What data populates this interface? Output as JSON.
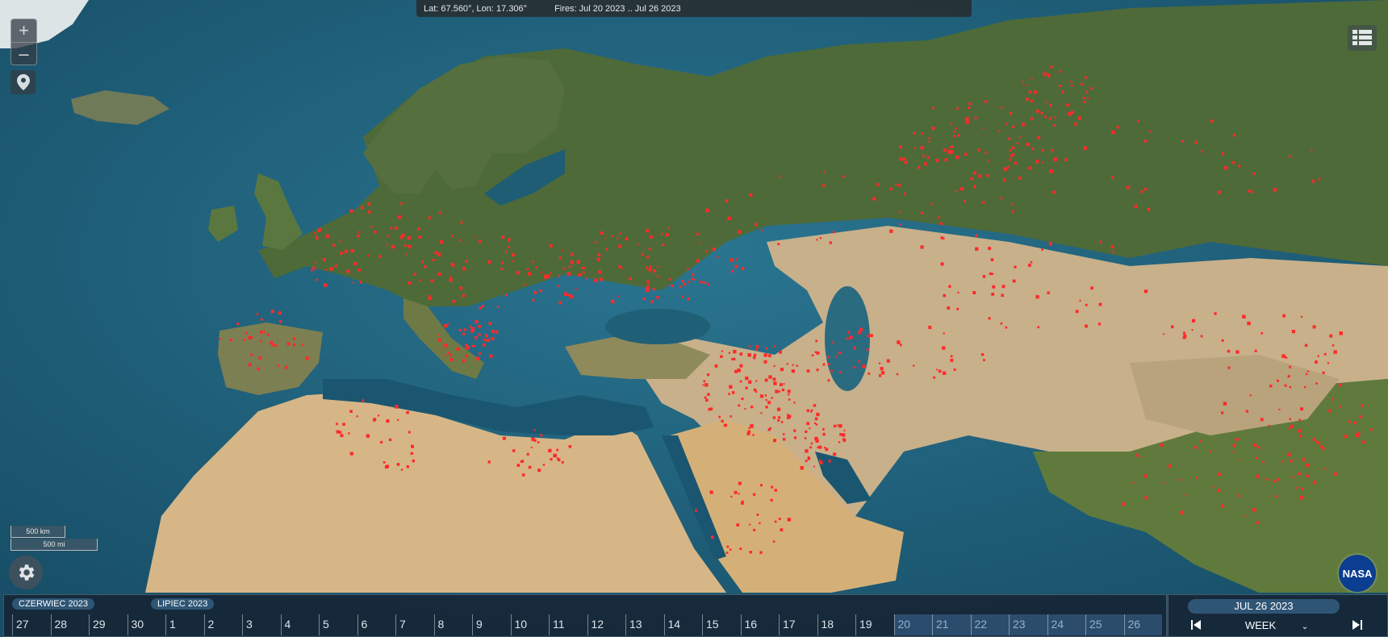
{
  "header": {
    "coords": "Lat: 67.560°, Lon: 17.306°",
    "fires": "Fires: Jul 20 2023 .. Jul 26 2023"
  },
  "map_controls": {
    "zoom_in": "+",
    "zoom_out": "–",
    "location_icon": "map-pin-icon",
    "layers_icon": "layers-list-icon",
    "settings_icon": "gear-icon"
  },
  "scale": {
    "km": "500 km",
    "mi": "500 mi"
  },
  "logo": {
    "text": "NASA"
  },
  "timeline": {
    "months": [
      {
        "label": "CZERWIEC 2023"
      },
      {
        "label": "LIPIEC 2023"
      }
    ],
    "days": [
      {
        "label": "27",
        "selected": false
      },
      {
        "label": "28",
        "selected": false
      },
      {
        "label": "29",
        "selected": false
      },
      {
        "label": "30",
        "selected": false
      },
      {
        "label": "1",
        "selected": false
      },
      {
        "label": "2",
        "selected": false
      },
      {
        "label": "3",
        "selected": false
      },
      {
        "label": "4",
        "selected": false
      },
      {
        "label": "5",
        "selected": false
      },
      {
        "label": "6",
        "selected": false
      },
      {
        "label": "7",
        "selected": false
      },
      {
        "label": "8",
        "selected": false
      },
      {
        "label": "9",
        "selected": false
      },
      {
        "label": "10",
        "selected": false
      },
      {
        "label": "11",
        "selected": false
      },
      {
        "label": "12",
        "selected": false
      },
      {
        "label": "13",
        "selected": false
      },
      {
        "label": "14",
        "selected": false
      },
      {
        "label": "15",
        "selected": false
      },
      {
        "label": "16",
        "selected": false
      },
      {
        "label": "17",
        "selected": false
      },
      {
        "label": "18",
        "selected": false
      },
      {
        "label": "19",
        "selected": false
      },
      {
        "label": "20",
        "selected": true
      },
      {
        "label": "21",
        "selected": true
      },
      {
        "label": "22",
        "selected": true
      },
      {
        "label": "23",
        "selected": true
      },
      {
        "label": "24",
        "selected": true
      },
      {
        "label": "25",
        "selected": true
      },
      {
        "label": "26",
        "selected": true
      }
    ]
  },
  "date_panel": {
    "current_date": "JUL 26 2023",
    "interval": "WEEK"
  },
  "colors": {
    "ocean": "#1d5a72",
    "land_north": "#4f6b3a",
    "desert": "#d9b98a",
    "fire": "#ff2a2a",
    "timeline_bg": "#16263a",
    "accent": "#2f5575"
  }
}
